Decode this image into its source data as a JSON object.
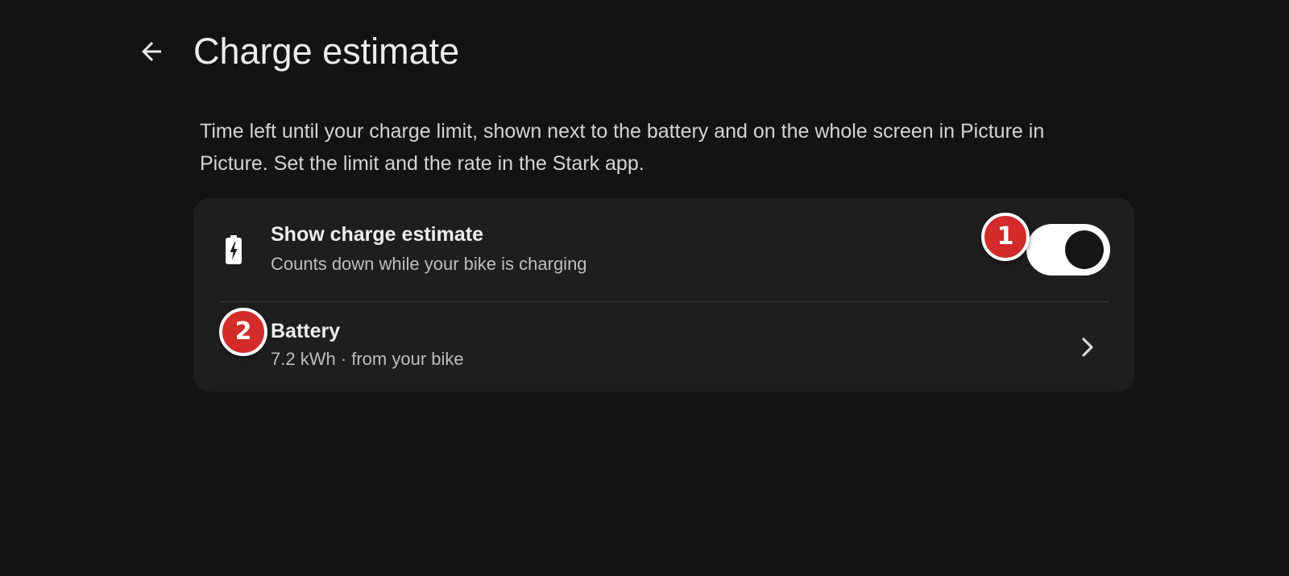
{
  "header": {
    "title": "Charge estimate",
    "back_icon": "arrow-back-icon"
  },
  "description": "Time left until your charge limit, shown next to the battery and on the whole screen in Picture in Picture. Set the limit and the rate in the Stark app.",
  "settings": {
    "show_estimate": {
      "title": "Show charge estimate",
      "subtitle": "Counts down while your bike is charging",
      "icon": "battery-charging-icon",
      "enabled": true
    },
    "battery": {
      "title": "Battery",
      "subtitle": "7.2 kWh · from your bike",
      "icon": "chevron-right-icon"
    }
  },
  "markers": [
    "1",
    "2"
  ],
  "colors": {
    "background": "#131313",
    "card": "#1e1e1e",
    "marker": "#d32a2a",
    "switch_track": "#ffffff",
    "switch_knob": "#151515"
  }
}
